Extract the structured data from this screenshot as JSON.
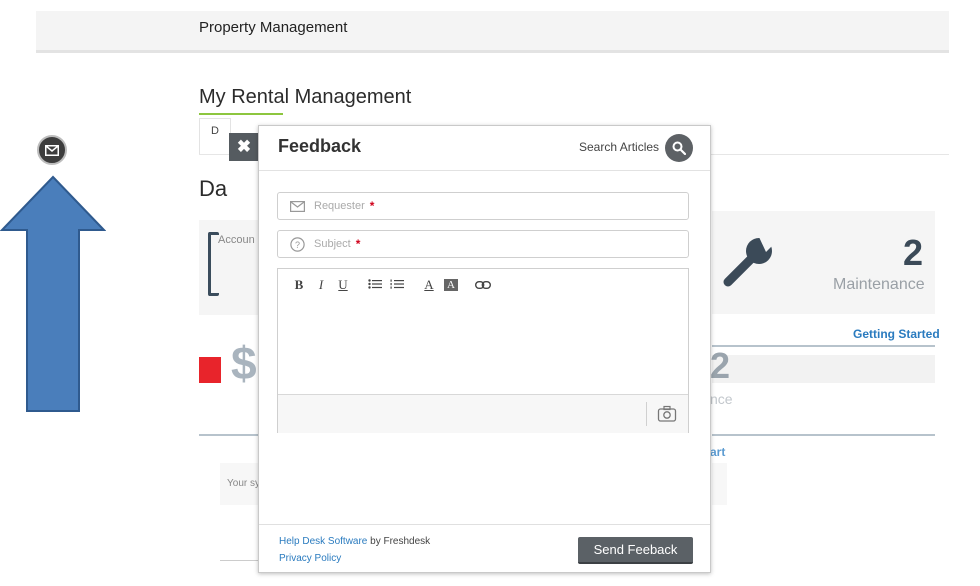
{
  "header": {
    "title": "Property Management"
  },
  "page": {
    "title": "My Rental Management",
    "tab_stub": "D",
    "dashboard_heading": "Da"
  },
  "background": {
    "account_label": "Accoun",
    "maintenance_count": "2",
    "maintenance_label": "Maintenance",
    "getting_started": "Getting Started",
    "dollar": "$",
    "partial_count": "2",
    "partial_label": "nce",
    "partial_link": "art",
    "your_sys": "Your sy"
  },
  "close_label": "✖",
  "modal": {
    "title": "Feedback",
    "search_label": "Search Articles",
    "requester_placeholder": "Requester",
    "subject_placeholder": "Subject",
    "required_mark": "*",
    "toolbar": {
      "bold": "B",
      "italic": "I",
      "underline": "U",
      "font_color": "A",
      "bg_color": "A"
    },
    "footer": {
      "software_link": "Help Desk Software",
      "by_text": " by Freshdesk",
      "privacy_link": "Privacy Policy"
    },
    "send_button": "Send Feeback"
  },
  "icons": {
    "floating": "envelope-icon",
    "search": "search-icon",
    "requester": "envelope-icon",
    "subject": "question-icon",
    "camera": "camera-icon",
    "wrench": "wrench-icon",
    "arrow": "up-arrow-annotation"
  },
  "colors": {
    "accent_green": "#8dc63f",
    "link_blue": "#2a7bbf",
    "button_gray": "#5b6166",
    "arrow_blue": "#4a7ebb",
    "required_red": "#d0021b"
  }
}
